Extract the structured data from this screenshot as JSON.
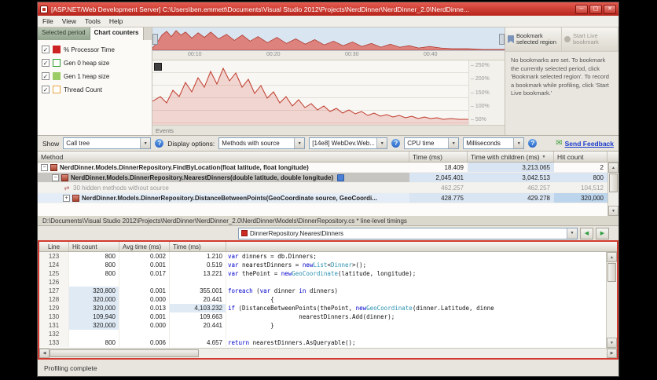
{
  "window": {
    "title": "[ASP.NET/Web Development Server] C:\\Users\\ben.emmett\\Documents\\Visual Studio 2012\\Projects\\NerdDinner\\NerdDinner_2.0\\NerdDinne...",
    "menu_items": [
      "File",
      "View",
      "Tools",
      "Help"
    ],
    "status": "Profiling complete"
  },
  "chart_panel": {
    "tabs": [
      {
        "label": "Selected period",
        "active": false
      },
      {
        "label": "Chart counters",
        "active": true
      }
    ],
    "counters": [
      {
        "label": "% Processor Time",
        "color": "#cc2222",
        "filled": true
      },
      {
        "label": "Gen 0 heap size",
        "color": "#2d9f2d",
        "filled": false
      },
      {
        "label": "Gen 1 heap size",
        "color": "#9ccc65",
        "filled": true
      },
      {
        "label": "Thread Count",
        "color": "#e8a33d",
        "filled": false
      }
    ],
    "time_labels": [
      "00:10",
      "00:20",
      "00:30",
      "00:40"
    ],
    "y_labels": [
      "250%",
      "200%",
      "150%",
      "100%",
      "50%"
    ],
    "events_label": "Events"
  },
  "bookmark_panel": {
    "bookmark_button": "Bookmark selected region",
    "live_button": "Start Live bookmark",
    "help_text": "No bookmarks are set. To bookmark the currently selected period, click 'Bookmark selected region'. To record a bookmark while profiling, click 'Start Live bookmark.'"
  },
  "toolbar": {
    "show_label": "Show",
    "show_value": "Call tree",
    "display_options_label": "Display options:",
    "filter_value": "Methods with source",
    "process_value": "[14e8] WebDev.Web...",
    "time_type_value": "CPU time",
    "units_value": "Milliseconds",
    "feedback_label": "Send Feedback"
  },
  "method_grid": {
    "columns": [
      "Method",
      "Time (ms)",
      "Time with children (ms)",
      "Hit count"
    ],
    "rows": [
      {
        "expand": "-",
        "indent": 0,
        "style": "normal",
        "method": "NerdDinner.Models.DinnerRepository.FindByLocation(float latitude, float longitude)",
        "time": "18.409",
        "time_with_children": "3,213.065",
        "hit_count": "2",
        "heat": {
          "time": 0,
          "twc": 1,
          "hits": 0
        }
      },
      {
        "expand": "-",
        "indent": 1,
        "style": "selected",
        "has_source_icon": true,
        "method": "NerdDinner.Models.DinnerRepository.NearestDinners(double latitude, double longitude)",
        "time": "2,045.401",
        "time_with_children": "3,042.513",
        "hit_count": "800",
        "heat": {
          "time": 1,
          "twc": 1,
          "hits": 1
        }
      },
      {
        "expand": "",
        "indent": 2,
        "style": "dim",
        "method": "30 hidden methods without source",
        "time": "462.257",
        "time_with_children": "462.257",
        "hit_count": "104,512",
        "heat": {
          "time": 0,
          "twc": 0,
          "hits": 0
        }
      },
      {
        "expand": "+",
        "indent": 2,
        "style": "highlight",
        "method": "NerdDinner.Models.DinnerRepository.DistanceBetweenPoints(GeoCoordinate source, GeoCoordi...",
        "time": "428.775",
        "time_with_children": "429.278",
        "hit_count": "320,000",
        "heat": {
          "time": 1,
          "twc": 1,
          "hits": 2
        }
      }
    ]
  },
  "source_view": {
    "path": "D:\\Documents\\Visual Studio 2012\\Projects\\NerdDinner\\NerdDinner_2.0\\NerdDinner\\Models\\DinnerRepository.cs * line-level timings",
    "method_selector": "DinnerRepository.NearestDinners",
    "columns": [
      "Line",
      "Hit count",
      "Avg time (ms)",
      "Time (ms)"
    ],
    "lines": [
      {
        "line": "123",
        "hit_count": "800",
        "avg_time": "0.002",
        "time": "1.210",
        "code": "var dinners = db.Dinners;",
        "indent": 0,
        "heat": 0,
        "time_heat": 0
      },
      {
        "line": "124",
        "hit_count": "800",
        "avg_time": "0.001",
        "time": "0.519",
        "code": "var nearestDinners = new List<Dinner>();",
        "indent": 0,
        "heat": 0,
        "time_heat": 0
      },
      {
        "line": "125",
        "hit_count": "800",
        "avg_time": "0.017",
        "time": "13.221",
        "code": "var thePoint = new GeoCoordinate(latitude, longitude);",
        "indent": 0,
        "heat": 0,
        "time_heat": 0
      },
      {
        "line": "126",
        "hit_count": "",
        "avg_time": "",
        "time": "",
        "code": "",
        "indent": 0,
        "heat": 0,
        "time_heat": 0
      },
      {
        "line": "127",
        "hit_count": "320,800",
        "avg_time": "0.001",
        "time": "355.001",
        "code": "foreach (var dinner in dinners)",
        "indent": 0,
        "heat": 1,
        "time_heat": 0
      },
      {
        "line": "128",
        "hit_count": "320,000",
        "avg_time": "0.000",
        "time": "20.441",
        "code": "{",
        "indent": 0,
        "heat": 1,
        "time_heat": 0
      },
      {
        "line": "129",
        "hit_count": "320,000",
        "avg_time": "0.013",
        "time": "4,103.232",
        "code": "if (DistanceBetweenPoints(thePoint, new GeoCoordinate(dinner.Latitude, dinne",
        "indent": 1,
        "heat": 1,
        "time_heat": 1
      },
      {
        "line": "130",
        "hit_count": "109,940",
        "avg_time": "0.001",
        "time": "109.663",
        "code": "nearestDinners.Add(dinner);",
        "indent": 2,
        "heat": 1,
        "time_heat": 0
      },
      {
        "line": "131",
        "hit_count": "320,000",
        "avg_time": "0.000",
        "time": "20.441",
        "code": "}",
        "indent": 0,
        "heat": 1,
        "time_heat": 0
      },
      {
        "line": "132",
        "hit_count": "",
        "avg_time": "",
        "time": "",
        "code": "",
        "indent": 0,
        "heat": 0,
        "time_heat": 0
      },
      {
        "line": "133",
        "hit_count": "800",
        "avg_time": "0.006",
        "time": "4.657",
        "code": "return nearestDinners.AsQueryable();",
        "indent": 0,
        "heat": 0,
        "time_heat": 0
      }
    ]
  },
  "syntax": {
    "keywords": [
      "var",
      "new",
      "foreach",
      "in",
      "if",
      "return"
    ],
    "types": [
      "List",
      "Dinner",
      "GeoCoordinate"
    ],
    "keyword_color": "#0000cc",
    "type_color": "#2b91af"
  },
  "colors": {
    "titlebar_red": "#b6231a",
    "titlebar_light": "#e65c50",
    "selection_red": "#d23a30",
    "series_red": "#c0392b",
    "link_blue": "#1a3acc"
  }
}
